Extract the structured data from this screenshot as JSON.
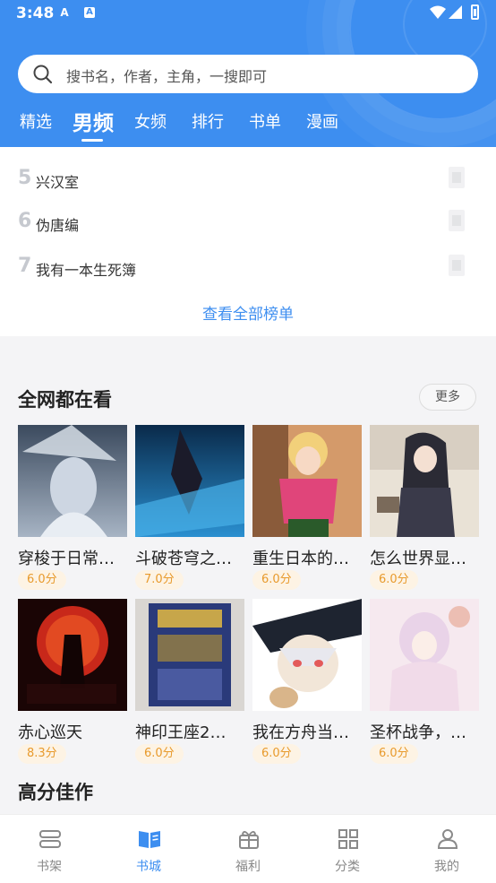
{
  "status_bar": {
    "time": "3:48",
    "notif_1": "A",
    "notif_2": "A"
  },
  "search": {
    "placeholder": "搜书名，作者，主角，一搜即可"
  },
  "tabs": [
    {
      "label": "精选",
      "active": false
    },
    {
      "label": "男频",
      "active": true
    },
    {
      "label": "女频",
      "active": false
    },
    {
      "label": "排行",
      "active": false
    },
    {
      "label": "书单",
      "active": false
    },
    {
      "label": "漫画",
      "active": false
    }
  ],
  "ranking": {
    "items": [
      {
        "rank": "5",
        "title": "兴汉室"
      },
      {
        "rank": "6",
        "title": "伪唐编"
      },
      {
        "rank": "7",
        "title": "我有一本生死簿"
      }
    ],
    "view_all": "查看全部榜单"
  },
  "popular": {
    "title": "全网都在看",
    "more": "更多",
    "books": [
      {
        "title": "穿梭于日常…",
        "score": "6.0分"
      },
      {
        "title": "斗破苍穹之…",
        "score": "7.0分"
      },
      {
        "title": "重生日本的…",
        "score": "6.0分"
      },
      {
        "title": "怎么世界显…",
        "score": "6.0分"
      },
      {
        "title": "赤心巡天",
        "score": "8.3分"
      },
      {
        "title": "神印王座2…",
        "score": "6.0分"
      },
      {
        "title": "我在方舟当…",
        "score": "6.0分"
      },
      {
        "title": "圣杯战争，…",
        "score": "6.0分"
      }
    ]
  },
  "high_score": {
    "title": "高分佳作"
  },
  "bottom_nav": [
    {
      "label": "书架",
      "icon": "bookshelf-icon",
      "active": false
    },
    {
      "label": "书城",
      "icon": "book-open-icon",
      "active": true
    },
    {
      "label": "福利",
      "icon": "gift-icon",
      "active": false
    },
    {
      "label": "分类",
      "icon": "grid-icon",
      "active": false
    },
    {
      "label": "我的",
      "icon": "user-icon",
      "active": false
    }
  ],
  "colors": {
    "primary": "#3d8ef0",
    "score_text": "#e89a2c",
    "score_bg": "#fdf3e4"
  }
}
